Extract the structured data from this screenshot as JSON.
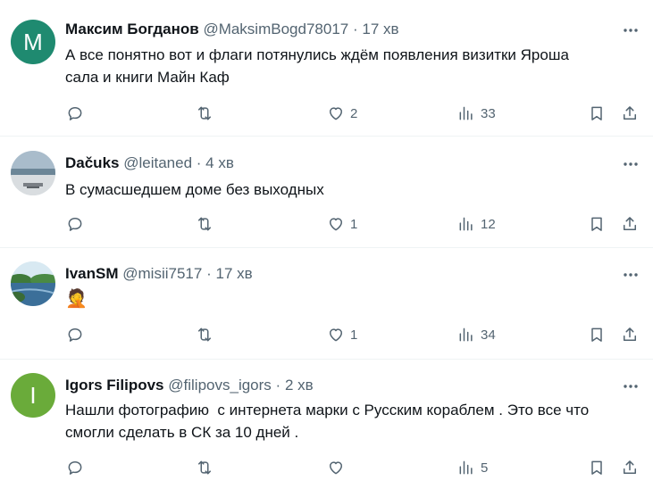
{
  "tweets": [
    {
      "avatar_letter": "M",
      "avatar_color": "#1f8a70",
      "name": "Максим Богданов",
      "handle": "@MaksimBogd78017",
      "time": "17 хв",
      "text_lines": [
        "А все понятно вот и флаги потянулись ждём появления визитки Яроша",
        "сала и книги Майн Каф"
      ],
      "replies": "",
      "reposts": "",
      "likes": "2",
      "views": "33"
    },
    {
      "avatar_image": "photo-beach",
      "name": "Dačuks",
      "handle": "@leitaned",
      "time": "4 хв",
      "text_lines": [
        "В сумасшедшем доме без выходных"
      ],
      "replies": "",
      "reposts": "",
      "likes": "1",
      "views": "12"
    },
    {
      "avatar_image": "photo-river",
      "name": "IvanSM",
      "handle": "@misii7517",
      "time": "17 хв",
      "text_lines": [
        "🤦"
      ],
      "replies": "",
      "reposts": "",
      "likes": "1",
      "views": "34"
    },
    {
      "avatar_letter": "I",
      "avatar_color": "#6aab3a",
      "name": "Igors Filipovs",
      "handle": "@filipovs_igors",
      "time": "2 хв",
      "text_lines": [
        "Нашли фотографию  с интернета марки с Русским кораблем . Это все что",
        "смогли сделать в СК за 10 дней ."
      ],
      "replies": "",
      "reposts": "",
      "likes": "",
      "views": "5"
    }
  ],
  "dot": "·"
}
